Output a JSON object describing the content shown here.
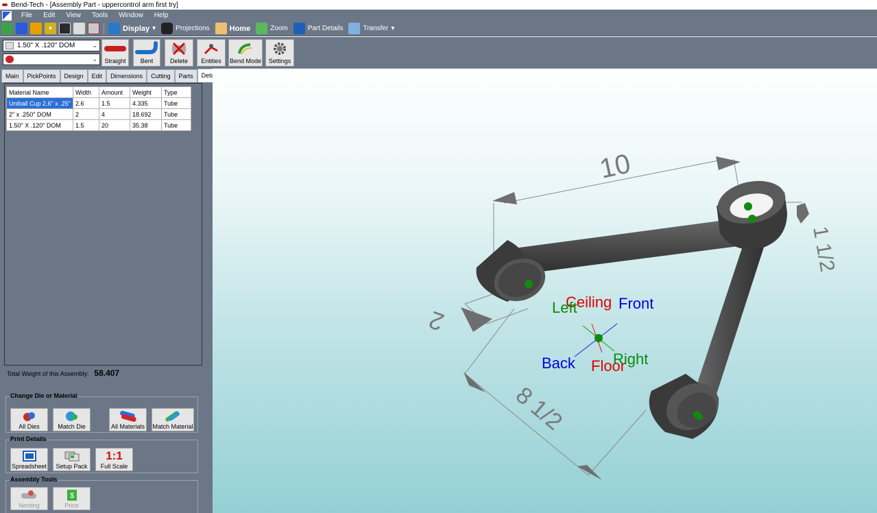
{
  "window": {
    "title": "Bend-Tech - [Assembly Part - uppercontrol arm first try]"
  },
  "menu": [
    "File",
    "Edit",
    "View",
    "Tools",
    "Window",
    "Help"
  ],
  "toolbar": {
    "display_label": "Display",
    "projections_label": "Projections",
    "home_label": "Home",
    "zoom_label": "Zoom",
    "part_details_label": "Part Details",
    "transfer_label": "Transfer"
  },
  "toolbar2": {
    "material_select": "1.50\" X .120\" DOM",
    "die_select": "",
    "buttons": [
      "Straight",
      "Bent",
      "Delete",
      "Entities",
      "Bend Mode",
      "Settings"
    ]
  },
  "tabs": [
    "Main",
    "PickPoints",
    "Design",
    "Edit",
    "Dimensions",
    "Cutting",
    "Parts",
    "Details"
  ],
  "active_tab": "Details",
  "materials_table": {
    "headers": [
      "Material Name",
      "Width",
      "Amount",
      "Weight",
      "Type"
    ],
    "rows": [
      [
        "Uniball Cup 2.6\" x .25\"",
        "2.6",
        "1.5",
        "4.335",
        "Tube"
      ],
      [
        "2\" x .250\" DOM",
        "2",
        "4",
        "18.692",
        "Tube"
      ],
      [
        "1.50\" X .120\" DOM",
        "1.5",
        "20",
        "35.38",
        "Tube"
      ]
    ]
  },
  "total_weight": {
    "label": "Total Weight of this Assembly:",
    "value": "58.407"
  },
  "groups": {
    "change_die": {
      "title": "Change Die or Material",
      "buttons": [
        "All Dies",
        "Match Die",
        "All Materials",
        "Match Material"
      ]
    },
    "print_details": {
      "title": "Print Details",
      "buttons": [
        "Spreadsheet",
        "Setup Pack",
        "Full Scale"
      ],
      "full_scale_glyph": "1:1"
    },
    "assembly_tools": {
      "title": "Assembly Tools",
      "buttons": [
        "Nesting",
        "Price"
      ]
    }
  },
  "viewport": {
    "dimensions": [
      "10",
      "1 1/2",
      "2",
      "8 1/2"
    ],
    "orientation_labels": {
      "ceiling": "Ceiling",
      "left": "Left",
      "front": "Front",
      "back": "Back",
      "floor": "Floor",
      "right": "Right"
    },
    "colors": {
      "ceiling": "#e00000",
      "floor": "#e00000",
      "left": "#0a8a0a",
      "right": "#0a8a0a",
      "front": "#0000e0",
      "back": "#0000e0",
      "tube": "#4a4a4a",
      "dim": "#7a7a7a"
    }
  }
}
